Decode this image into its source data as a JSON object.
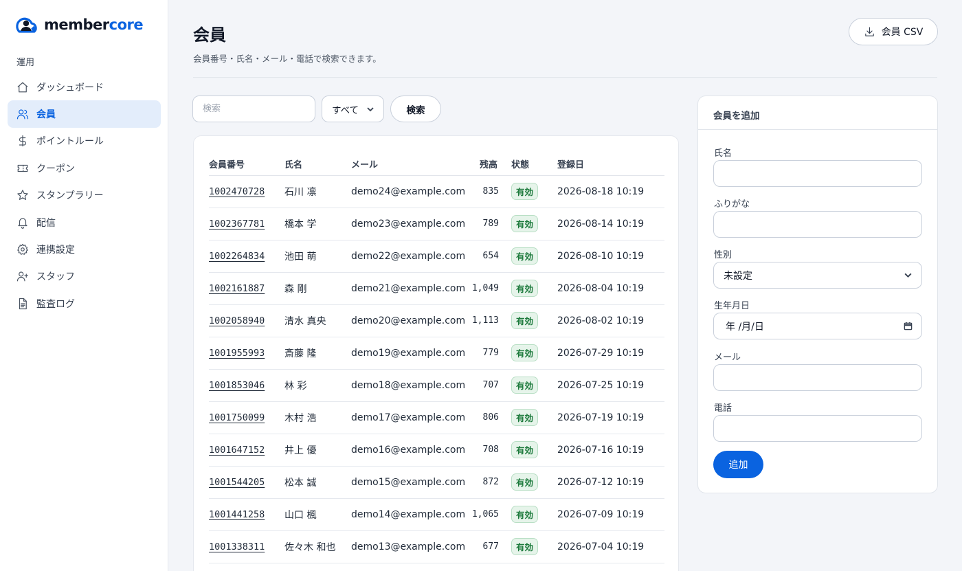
{
  "brand": {
    "name_part1": "member",
    "name_part2": "core",
    "color": "#0a63e0"
  },
  "sidebar": {
    "section_label": "運用",
    "items": [
      {
        "label": "ダッシュボード",
        "icon": "home-icon",
        "active": false
      },
      {
        "label": "会員",
        "icon": "users-icon",
        "active": true
      },
      {
        "label": "ポイントルール",
        "icon": "dollar-icon",
        "active": false
      },
      {
        "label": "クーポン",
        "icon": "ticket-icon",
        "active": false
      },
      {
        "label": "スタンプラリー",
        "icon": "star-icon",
        "active": false
      },
      {
        "label": "配信",
        "icon": "bell-icon",
        "active": false
      },
      {
        "label": "連携設定",
        "icon": "gear-icon",
        "active": false
      },
      {
        "label": "スタッフ",
        "icon": "user-plus-icon",
        "active": false
      },
      {
        "label": "監査ログ",
        "icon": "document-icon",
        "active": false
      }
    ]
  },
  "header": {
    "title": "会員",
    "subtitle": "会員番号・氏名・メール・電話で検索できます。",
    "csv_button": "会員 CSV"
  },
  "search": {
    "placeholder": "検索",
    "filter_value": "すべて",
    "button": "検索"
  },
  "table": {
    "columns": {
      "id": "会員番号",
      "name": "氏名",
      "mail": "メール",
      "balance": "残高",
      "status": "状態",
      "date": "登録日"
    },
    "rows": [
      {
        "id": "1002470728",
        "name": "石川 凛",
        "mail": "demo24@example.com",
        "balance": "835",
        "status": "有効",
        "date": "2026-08-18 10:19"
      },
      {
        "id": "1002367781",
        "name": "橋本 学",
        "mail": "demo23@example.com",
        "balance": "789",
        "status": "有効",
        "date": "2026-08-14 10:19"
      },
      {
        "id": "1002264834",
        "name": "池田 萌",
        "mail": "demo22@example.com",
        "balance": "654",
        "status": "有効",
        "date": "2026-08-10 10:19"
      },
      {
        "id": "1002161887",
        "name": "森 剛",
        "mail": "demo21@example.com",
        "balance": "1,049",
        "status": "有効",
        "date": "2026-08-04 10:19"
      },
      {
        "id": "1002058940",
        "name": "清水 真央",
        "mail": "demo20@example.com",
        "balance": "1,113",
        "status": "有効",
        "date": "2026-08-02 10:19"
      },
      {
        "id": "1001955993",
        "name": "斎藤 隆",
        "mail": "demo19@example.com",
        "balance": "779",
        "status": "有効",
        "date": "2026-07-29 10:19"
      },
      {
        "id": "1001853046",
        "name": "林 彩",
        "mail": "demo18@example.com",
        "balance": "707",
        "status": "有効",
        "date": "2026-07-25 10:19"
      },
      {
        "id": "1001750099",
        "name": "木村 浩",
        "mail": "demo17@example.com",
        "balance": "806",
        "status": "有効",
        "date": "2026-07-19 10:19"
      },
      {
        "id": "1001647152",
        "name": "井上 優",
        "mail": "demo16@example.com",
        "balance": "708",
        "status": "有効",
        "date": "2026-07-16 10:19"
      },
      {
        "id": "1001544205",
        "name": "松本 誠",
        "mail": "demo15@example.com",
        "balance": "872",
        "status": "有効",
        "date": "2026-07-12 10:19"
      },
      {
        "id": "1001441258",
        "name": "山口 楓",
        "mail": "demo14@example.com",
        "balance": "1,065",
        "status": "有効",
        "date": "2026-07-09 10:19"
      },
      {
        "id": "1001338311",
        "name": "佐々木 和也",
        "mail": "demo13@example.com",
        "balance": "677",
        "status": "有効",
        "date": "2026-07-04 10:19"
      }
    ]
  },
  "add_form": {
    "title": "会員を追加",
    "name_label": "氏名",
    "kana_label": "ふりがな",
    "gender_label": "性別",
    "gender_value": "未設定",
    "birth_label": "生年月日",
    "birth_placeholder": "年 /月/日",
    "mail_label": "メール",
    "phone_label": "電話",
    "submit": "追加"
  }
}
